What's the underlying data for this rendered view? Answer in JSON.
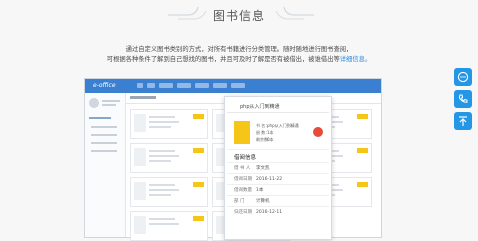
{
  "header": {
    "title": "图书信息",
    "desc_line1": "通过自定义图书类别的方式，对所有书籍进行分类管理。随时随地进行图书查阅，",
    "desc_line2_pre": "可根据各种条件了解到自己想找的图书，并且可及时了解是否有被借出，被谁借出等",
    "desc_line2_hl": "详细信息。"
  },
  "app": {
    "logo": "e-office",
    "popup": {
      "title": "php从入门到精通",
      "book": {
        "name_label": "书 名：",
        "name": "php从入门到精通",
        "count_label": "册 数：",
        "count": "1本",
        "remain_label": "剩余数：",
        "remain": "0本"
      },
      "borrow_title": "借阅信息",
      "rows": [
        {
          "label": "借 书 人",
          "value": "李文凯"
        },
        {
          "label": "借阅日期",
          "value": "2016-11-22"
        },
        {
          "label": "借阅数量",
          "value": "1本"
        },
        {
          "label": "部    门",
          "value": "计算机"
        },
        {
          "label": "归还日期",
          "value": "2016-12-11"
        }
      ]
    }
  },
  "floating": {
    "icons": [
      "chat-icon",
      "phone-icon",
      "back-to-top-icon"
    ]
  },
  "colors": {
    "accent": "#2396e6",
    "topbar": "#3a7fd0",
    "book_yellow": "#f5c518",
    "remove_red": "#e64b3c"
  }
}
